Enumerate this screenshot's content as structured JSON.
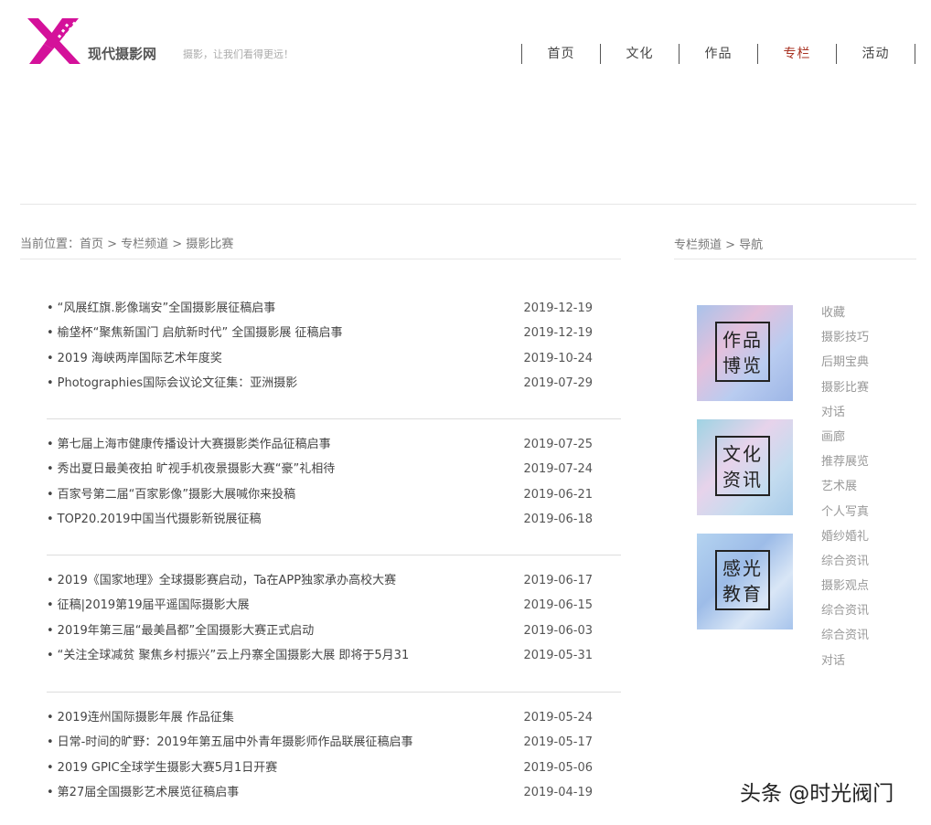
{
  "header": {
    "site_name": "现代摄影网",
    "slogan": "摄影，让我们看得更远！",
    "logo_color": "#d4119a",
    "nav": [
      {
        "label": "首页",
        "active": false
      },
      {
        "label": "文化",
        "active": false
      },
      {
        "label": "作品",
        "active": false
      },
      {
        "label": "专栏",
        "active": true
      },
      {
        "label": "活动",
        "active": false
      }
    ]
  },
  "breadcrumb": {
    "main": "当前位置：首页 > 专栏频道 > 摄影比赛",
    "side": "专栏频道 > 导航"
  },
  "articles": [
    [
      {
        "title": "“风展红旗.影像瑞安”全国摄影展征稿启事",
        "date": "2019-12-19"
      },
      {
        "title": "榆垡杯“聚焦新国门 启航新时代”  全国摄影展 征稿启事",
        "date": "2019-12-19"
      },
      {
        "title": "2019 海峡两岸国际艺术年度奖",
        "date": "2019-10-24"
      },
      {
        "title": "Photographies国际会议论文征集：亚洲摄影",
        "date": "2019-07-29"
      }
    ],
    [
      {
        "title": "第七届上海市健康传播设计大赛摄影类作品征稿启事",
        "date": "2019-07-25"
      },
      {
        "title": "秀出夏日最美夜拍 旷视手机夜景摄影大赛“豪”礼相待",
        "date": "2019-07-24"
      },
      {
        "title": "百家号第二届“百家影像”摄影大展喊你来投稿",
        "date": "2019-06-21"
      },
      {
        "title": "TOP20.2019中国当代摄影新锐展征稿",
        "date": "2019-06-18"
      }
    ],
    [
      {
        "title": "2019《国家地理》全球摄影赛启动，Ta在APP独家承办高校大赛",
        "date": "2019-06-17"
      },
      {
        "title": "征稿|2019第19届平遥国际摄影大展",
        "date": "2019-06-15"
      },
      {
        "title": "2019年第三届“最美昌都”全国摄影大赛正式启动",
        "date": "2019-06-03"
      },
      {
        "title": "“关注全球减贫 聚焦乡村振兴”云上丹寨全国摄影大展 即将于5月31",
        "date": "2019-05-31"
      }
    ],
    [
      {
        "title": "2019连州国际摄影年展 作品征集",
        "date": "2019-05-24"
      },
      {
        "title": "日常-时间的旷野：2019年第五届中外青年摄影师作品联展征稿启事",
        "date": "2019-05-17"
      },
      {
        "title": "2019 GPIC全球学生摄影大赛5月1日开赛",
        "date": "2019-05-06"
      },
      {
        "title": "第27届全国摄影艺术展览征稿启事",
        "date": "2019-04-19"
      }
    ]
  ],
  "bullet": "•",
  "tiles": [
    {
      "line1": "作品",
      "line2": "博览"
    },
    {
      "line1": "文化",
      "line2": "资讯"
    },
    {
      "line1": "感光",
      "line2": "教育"
    }
  ],
  "side_links": [
    "收藏",
    "摄影技巧",
    "后期宝典",
    "摄影比赛",
    "对话",
    "画廊",
    "推荐展览",
    "艺术展",
    "个人写真",
    "婚纱婚礼",
    "综合资讯",
    "摄影观点",
    "综合资讯",
    "综合资讯",
    "对话"
  ],
  "watermark": "头条 @时光阀门"
}
